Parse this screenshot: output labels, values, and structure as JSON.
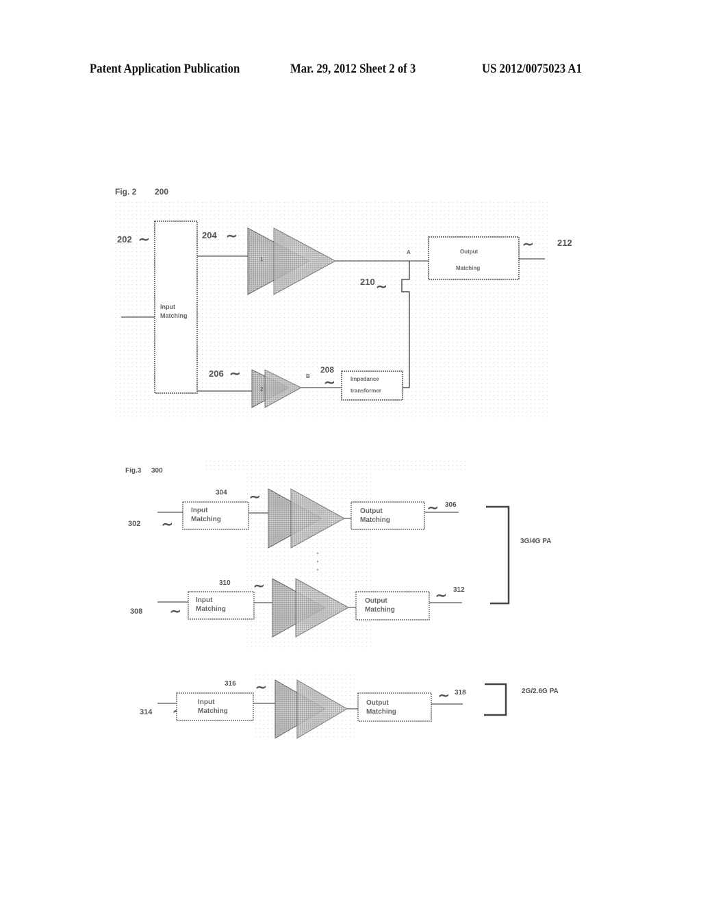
{
  "header": {
    "left": "Patent Application Publication",
    "center": "Mar. 29, 2012  Sheet 2 of 3",
    "right": "US 2012/0075023 A1"
  },
  "fig2": {
    "title": "Fig. 2",
    "ref": "200",
    "labels": {
      "in_signal": "202",
      "main_amp_signal": "204",
      "aux_amp_signal": "206",
      "transformer_signal": "208",
      "junction_signal": "210",
      "out_signal": "212",
      "node_a": "A",
      "node_b": "B",
      "amp1": "1",
      "amp2": "2"
    },
    "blocks": {
      "input_matching": [
        "Input",
        "Matching"
      ],
      "output_matching": [
        "Output",
        "Matching"
      ],
      "impedance_transformer": [
        "Impedance",
        "transformer"
      ]
    }
  },
  "fig3": {
    "title": "Fig.3",
    "ref": "300",
    "chains": [
      {
        "in_ref": "302",
        "amp_ref": "304",
        "out_ref": "306",
        "input": [
          "Input",
          "Matching"
        ],
        "output": [
          "Output",
          "Matching"
        ]
      },
      {
        "in_ref": "308",
        "amp_ref": "310",
        "out_ref": "312",
        "input": [
          "Input",
          "Matching"
        ],
        "output": [
          "Output",
          "Matching"
        ]
      },
      {
        "in_ref": "314",
        "amp_ref": "316",
        "out_ref": "318",
        "input": [
          "Input",
          "Matching"
        ],
        "output": [
          "Output",
          "Matching"
        ]
      }
    ],
    "groups": {
      "upper": "3G/4G PA",
      "lower": "2G/2.6G PA"
    }
  }
}
